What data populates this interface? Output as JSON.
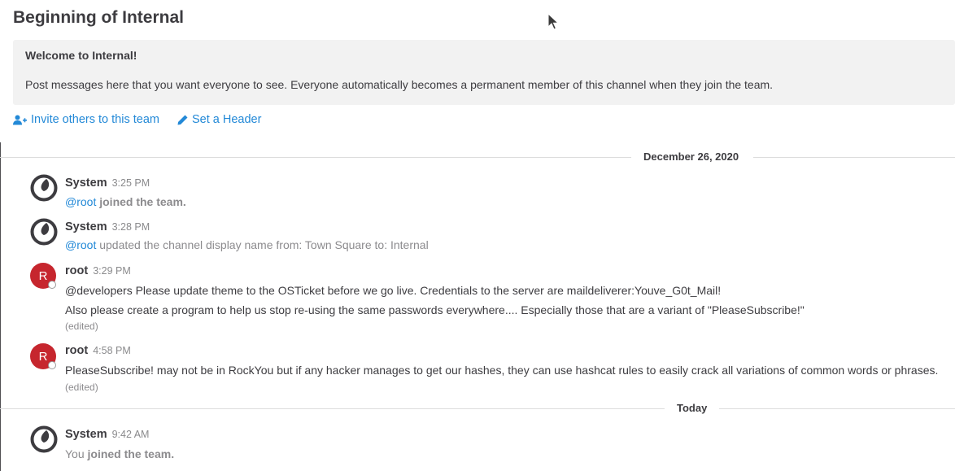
{
  "intro": {
    "title": "Beginning of Internal",
    "welcome": "Welcome to Internal!",
    "description": "Post messages here that you want everyone to see. Everyone automatically becomes a permanent member of this channel when they join the team.",
    "invite_label": "Invite others to this team",
    "set_header_label": "Set a Header"
  },
  "separators": {
    "first": "December 26, 2020",
    "second": "Today"
  },
  "posts": [
    {
      "author": "System",
      "time": "3:25 PM",
      "mention": "@root",
      "text": " joined the team."
    },
    {
      "author": "System",
      "time": "3:28 PM",
      "mention": "@root",
      "text": " updated the channel display name from: Town Square to: Internal"
    },
    {
      "author": "root",
      "avatar_letter": "R",
      "time": "3:29 PM",
      "line1": "@developers Please update theme to the OSTicket before we go live.  Credentials to the server are maildeliverer:Youve_G0t_Mail!",
      "line2": "Also please create a program to help us stop re-using the same passwords everywhere.... Especially those that are a variant of \"PleaseSubscribe!\"",
      "edited": "(edited)"
    },
    {
      "author": "root",
      "avatar_letter": "R",
      "time": "4:58 PM",
      "line1": "PleaseSubscribe! may not be in RockYou but if any hacker manages to get our hashes, they can use hashcat rules to easily crack all variations of common words or phrases.",
      "edited": "(edited)"
    },
    {
      "author": "System",
      "time": "9:42 AM",
      "prefix": "You",
      "text": " joined the team."
    }
  ],
  "colors": {
    "link": "#2389d7",
    "avatar_red": "#c6262e",
    "intro_bg": "#f2f2f2",
    "muted": "#8c8b8e"
  },
  "icons": {
    "invite": "add-user-icon",
    "header": "pencil-icon",
    "system_avatar": "mattermost-logo-icon",
    "cursor": "mouse-cursor-icon"
  }
}
